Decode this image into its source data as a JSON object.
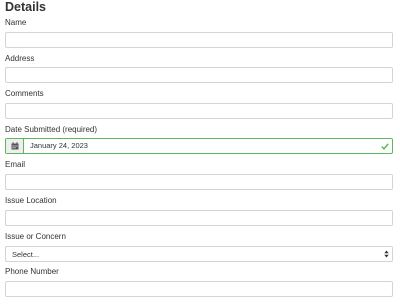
{
  "form": {
    "title": "Details",
    "name_label": "Name",
    "address_label": "Address",
    "comments_label": "Comments",
    "date_label": "Date Submitted (required)",
    "date_value": "January 24, 2023",
    "email_label": "Email",
    "issue_location_label": "Issue Location",
    "issue_label": "Issue or Concern",
    "issue_selected": "Select...",
    "phone_label": "Phone Number"
  },
  "colors": {
    "valid_border": "#5cb85c",
    "field_border": "#d4d4d4",
    "addon_bg": "#eeeeee"
  },
  "icons": {
    "date_addon": "calendar-icon",
    "date_status": "checkmark-icon",
    "select_caret": "sort-arrows-icon"
  }
}
